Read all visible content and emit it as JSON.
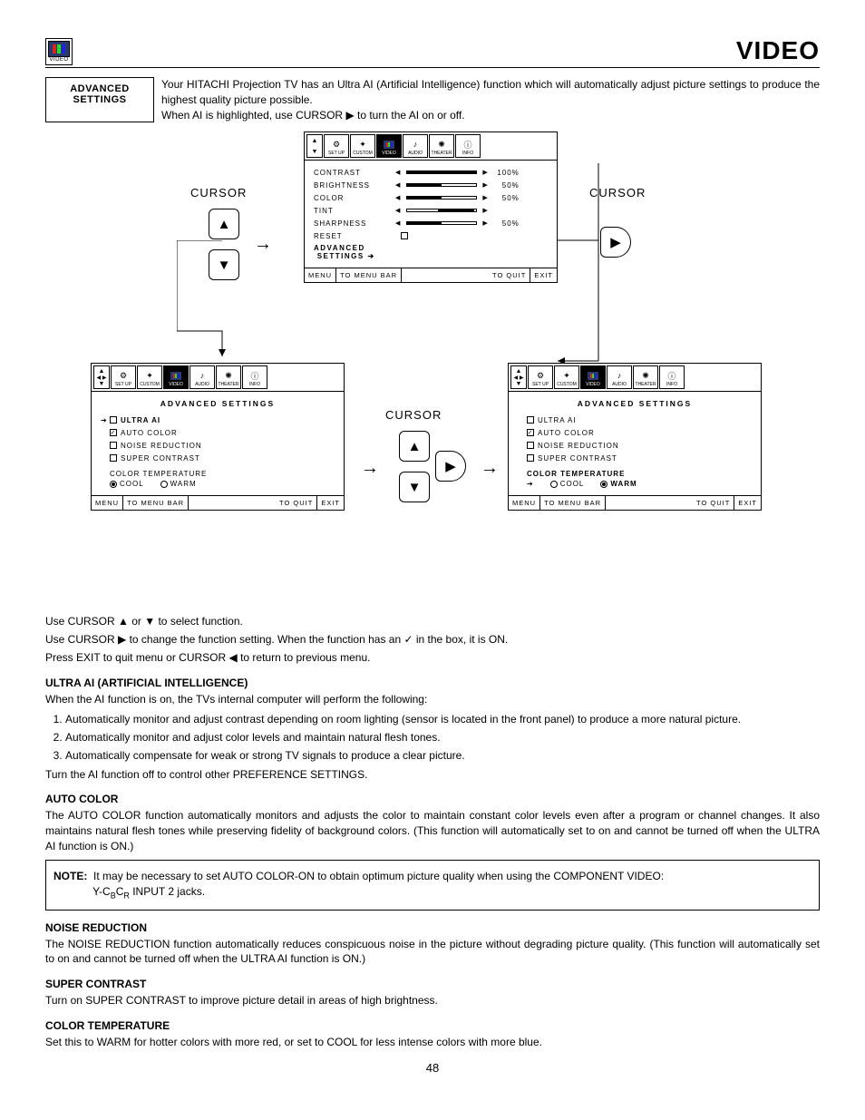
{
  "header": {
    "badge_label": "VIDEO",
    "title": "VIDEO"
  },
  "intro": {
    "box_l1": "ADVANCED",
    "box_l2": "SETTINGS",
    "p1": "Your HITACHI Projection TV has an Ultra AI (Artificial Intelligence) function which will automatically adjust picture settings to produce the highest quality picture possible.",
    "p2_a": "When AI is highlighted, use CURSOR ",
    "p2_b": " to turn the AI on or off."
  },
  "menubar": {
    "tabs": [
      "SET UP",
      "CUSTOM",
      "VIDEO",
      "AUDIO",
      "THEATER",
      "INFO"
    ]
  },
  "osd_top": {
    "rows": [
      {
        "label": "CONTRAST",
        "pct": "100%",
        "fill": 100
      },
      {
        "label": "BRIGHTNESS",
        "pct": "50%",
        "fill": 50
      },
      {
        "label": "COLOR",
        "pct": "50%",
        "fill": 50
      },
      {
        "label": "TINT",
        "pct": "",
        "fill": 50,
        "center": true
      },
      {
        "label": "SHARPNESS",
        "pct": "50%",
        "fill": 50
      }
    ],
    "reset": "RESET",
    "adv_l1": "ADVANCED",
    "adv_l2": "SETTINGS"
  },
  "osd_footer": {
    "a": "MENU",
    "b": "TO MENU BAR",
    "c": "TO QUIT",
    "d": "EXIT"
  },
  "cursor_label": "CURSOR",
  "adv_left": {
    "heading": "ADVANCED SETTINGS",
    "opts": [
      {
        "label": "ULTRA AI",
        "ptr": true,
        "checked": false,
        "bold": true
      },
      {
        "label": "AUTO COLOR",
        "ptr": false,
        "checked": true
      },
      {
        "label": "NOISE REDUCTION",
        "ptr": false,
        "checked": false
      },
      {
        "label": "SUPER CONTRAST",
        "ptr": false,
        "checked": false
      }
    ],
    "ct_label": "COLOR TEMPERATURE",
    "cool": "COOL",
    "warm": "WARM",
    "sel": "cool",
    "ct_bold": false
  },
  "adv_right": {
    "heading": "ADVANCED SETTINGS",
    "opts": [
      {
        "label": "ULTRA AI",
        "ptr": false,
        "checked": false
      },
      {
        "label": "AUTO COLOR",
        "ptr": false,
        "checked": true
      },
      {
        "label": "NOISE REDUCTION",
        "ptr": false,
        "checked": false
      },
      {
        "label": "SUPER CONTRAST",
        "ptr": false,
        "checked": false
      }
    ],
    "ct_label": "COLOR TEMPERATURE",
    "cool": "COOL",
    "warm": "WARM",
    "sel": "warm",
    "ct_bold": true,
    "ptr": true
  },
  "instructions": {
    "l1a": "Use CURSOR ",
    "l1b": " or ",
    "l1c": " to select function.",
    "l2a": "Use CURSOR ",
    "l2b": " to change the function setting. When the function has an ",
    "l2c": " in the box, it is ON.",
    "l3a": "Press EXIT to quit menu or CURSOR ",
    "l3b": " to return to previous menu."
  },
  "ultra_ai": {
    "h": "ULTRA AI (ARTIFICIAL INTELLIGENCE)",
    "intro": "When the AI function is on, the TVs  internal computer will perform the following:",
    "items": [
      "Automatically monitor and adjust contrast depending on room lighting (sensor is located in the front panel) to produce a more natural picture.",
      "Automatically monitor and adjust color levels and maintain natural flesh tones.",
      "Automatically compensate for weak or strong TV signals to produce a clear picture."
    ],
    "off": "Turn the AI function off to control other PREFERENCE SETTINGS."
  },
  "auto_color": {
    "h": "AUTO COLOR",
    "p": "The AUTO COLOR function automatically monitors and adjusts the color to maintain constant color levels even after a program or channel changes. It also maintains natural flesh tones while preserving fidelity of background colors. (This function will automatically set to on and cannot be turned off when the ULTRA AI function is ON.)"
  },
  "note": {
    "label": "NOTE:",
    "t1": "It may be necessary to set AUTO COLOR-ON to obtain optimum picture quality when using the COMPONENT VIDEO:",
    "t2a": "Y-C",
    "t2b": "B",
    "t2c": "C",
    "t2d": "R",
    "t2e": " INPUT 2 jacks."
  },
  "nr": {
    "h": "NOISE REDUCTION",
    "p": "The NOISE REDUCTION function automatically reduces conspicuous noise in the picture without degrading picture quality. (This function will automatically set to on and cannot be turned off when the ULTRA AI function is ON.)"
  },
  "sc": {
    "h": "SUPER CONTRAST",
    "p": "Turn on SUPER CONTRAST to improve picture detail in areas of high brightness."
  },
  "ct": {
    "h": "COLOR TEMPERATURE",
    "p": "Set this to WARM for hotter colors with more red, or set to COOL for less intense colors with more blue."
  },
  "page": "48"
}
